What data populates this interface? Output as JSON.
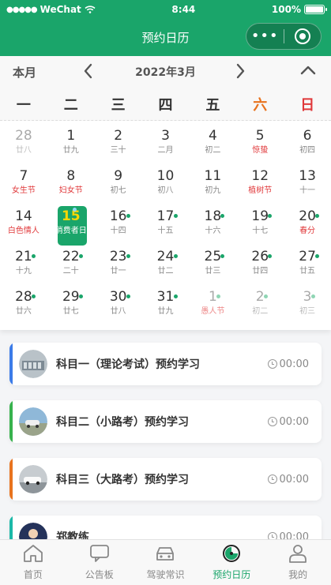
{
  "status": {
    "carrier": "WeChat",
    "time": "8:44",
    "battery": "100%"
  },
  "nav": {
    "title": "预约日历",
    "more": "•••"
  },
  "calendar": {
    "mode": "本月",
    "month": "2022年3月",
    "weekdays": [
      "一",
      "二",
      "三",
      "四",
      "五",
      "六",
      "日"
    ],
    "weekday_colors": [
      "#333",
      "#333",
      "#333",
      "#333",
      "#333",
      "#e8731e",
      "#e0393b"
    ],
    "days": [
      {
        "d": "28",
        "l": "廿八",
        "dim": true
      },
      {
        "d": "1",
        "l": "廿九"
      },
      {
        "d": "2",
        "l": "三十"
      },
      {
        "d": "3",
        "l": "二月"
      },
      {
        "d": "4",
        "l": "初二"
      },
      {
        "d": "5",
        "l": "惊蛰",
        "red": true
      },
      {
        "d": "6",
        "l": "初四"
      },
      {
        "d": "7",
        "l": "女生节",
        "red": true
      },
      {
        "d": "8",
        "l": "妇女节",
        "red": true
      },
      {
        "d": "9",
        "l": "初七"
      },
      {
        "d": "10",
        "l": "初八"
      },
      {
        "d": "11",
        "l": "初九"
      },
      {
        "d": "12",
        "l": "植树节",
        "red": true
      },
      {
        "d": "13",
        "l": "十一"
      },
      {
        "d": "14",
        "l": "白色情人",
        "red": true
      },
      {
        "d": "15",
        "l": "消费者日",
        "today": true,
        "dot": true
      },
      {
        "d": "16",
        "l": "十四",
        "dot": true
      },
      {
        "d": "17",
        "l": "十五",
        "dot": true
      },
      {
        "d": "18",
        "l": "十六",
        "dot": true
      },
      {
        "d": "19",
        "l": "十七",
        "dot": true
      },
      {
        "d": "20",
        "l": "春分",
        "red": true,
        "dot": true
      },
      {
        "d": "21",
        "l": "十九",
        "dot": true
      },
      {
        "d": "22",
        "l": "二十",
        "dot": true
      },
      {
        "d": "23",
        "l": "廿一",
        "dot": true
      },
      {
        "d": "24",
        "l": "廿二",
        "dot": true
      },
      {
        "d": "25",
        "l": "廿三",
        "dot": true
      },
      {
        "d": "26",
        "l": "廿四",
        "dot": true
      },
      {
        "d": "27",
        "l": "廿五",
        "dot": true
      },
      {
        "d": "28",
        "l": "廿六",
        "dot": true
      },
      {
        "d": "29",
        "l": "廿七",
        "dot": true
      },
      {
        "d": "30",
        "l": "廿八",
        "dot": true
      },
      {
        "d": "31",
        "l": "廿九",
        "dot": true
      },
      {
        "d": "1",
        "l": "愚人节",
        "red": true,
        "dim": true,
        "dot": true
      },
      {
        "d": "2",
        "l": "初二",
        "dim": true,
        "dot": true
      },
      {
        "d": "3",
        "l": "初三",
        "dim": true,
        "dot": true
      }
    ]
  },
  "items": [
    {
      "title": "科目一（理论考试）预约学习",
      "time": "00:00",
      "color": "#3b7be8",
      "avatar": "subject1-avatar"
    },
    {
      "title": "科目二（小路考）预约学习",
      "time": "00:00",
      "color": "#37b24d",
      "avatar": "subject2-avatar"
    },
    {
      "title": "科目三（大路考）预约学习",
      "time": "00:00",
      "color": "#e8731e",
      "avatar": "subject3-avatar"
    },
    {
      "title": "郑教练",
      "time": "00:00",
      "color": "#1bb8a8",
      "avatar": "coach-avatar"
    }
  ],
  "tabs": [
    {
      "label": "首页",
      "icon": "home-icon"
    },
    {
      "label": "公告板",
      "icon": "message-icon"
    },
    {
      "label": "驾驶常识",
      "icon": "car-icon"
    },
    {
      "label": "预约日历",
      "icon": "calendar-clock-icon",
      "active": true
    },
    {
      "label": "我的",
      "icon": "user-icon"
    }
  ],
  "colors": {
    "primary": "#1aa56a",
    "holiday": "#e0393b",
    "today_number": "#ffd700"
  }
}
